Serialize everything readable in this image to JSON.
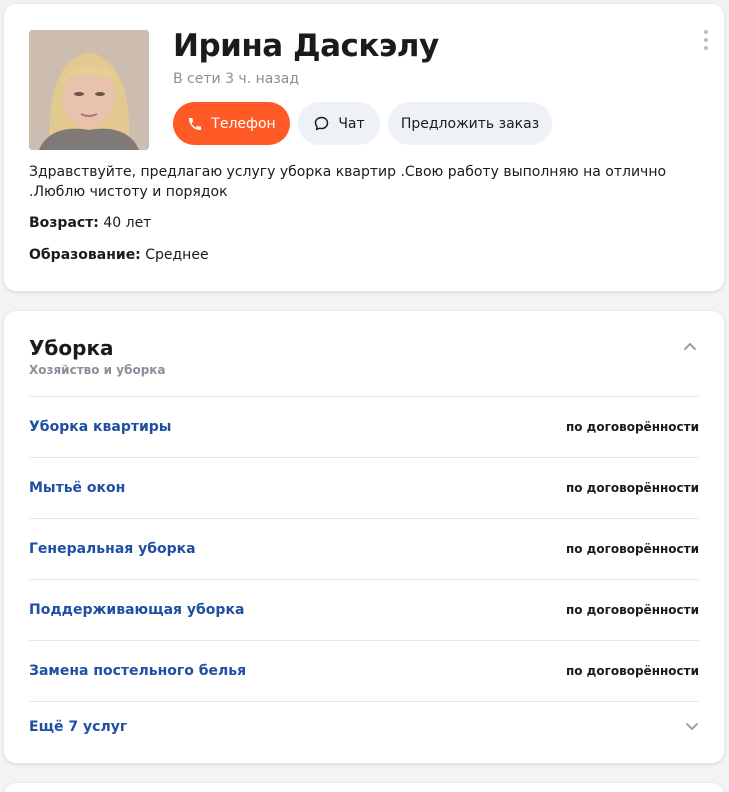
{
  "profile": {
    "name": "Ирина Даскэлу",
    "status": "В сети 3 ч. назад",
    "phone_label": "Телефон",
    "chat_label": "Чат",
    "order_label": "Предложить заказ",
    "about": "Здравствуйте, предлагаю услугу уборка квартир .Свою работу выполняю на отлично .Люблю чистоту и порядок",
    "age_label": "Возраст:",
    "age_value": " 40 лет",
    "education_label": "Образование:",
    "education_value": " Среднее",
    "icons": {
      "phone": "phone-icon",
      "chat": "chat-bubble-icon",
      "more": "more-vertical-icon"
    },
    "colors": {
      "accent": "#ff5a26",
      "secondary_button": "#eef1f6"
    }
  },
  "services": {
    "title": "Уборка",
    "subtitle": "Хозяйство и уборка",
    "items": [
      {
        "name": "Уборка квартиры",
        "price": "по договорённости"
      },
      {
        "name": "Мытьё окон",
        "price": "по договорённости"
      },
      {
        "name": "Генеральная уборка",
        "price": "по договорённости"
      },
      {
        "name": "Поддерживающая уборка",
        "price": "по договорённости"
      },
      {
        "name": "Замена постельного белья",
        "price": "по договорённости"
      }
    ],
    "more_label": "Ещё 7 услуг",
    "colors": {
      "link": "#1f4fa3"
    }
  }
}
